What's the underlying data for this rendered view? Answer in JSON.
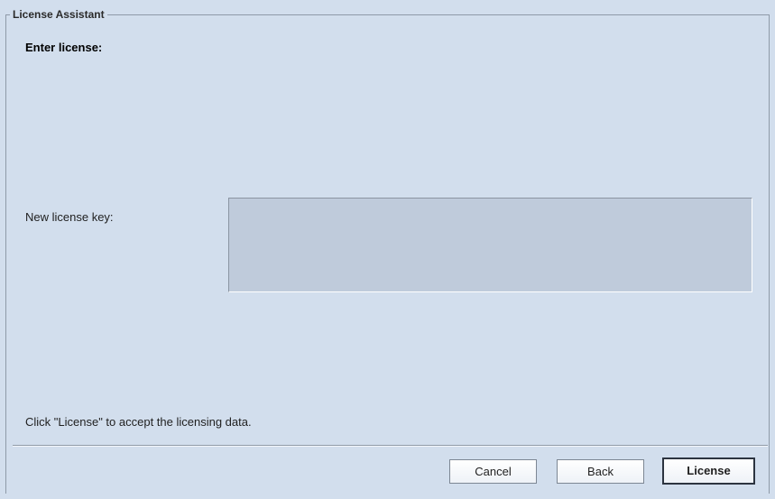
{
  "dialog": {
    "title": "License Assistant",
    "heading": "Enter license:",
    "license_key_label": "New license key:",
    "license_key_value": "",
    "hint": "Click \"License\" to accept the licensing data."
  },
  "buttons": {
    "cancel": "Cancel",
    "back": "Back",
    "license": "License"
  },
  "colors": {
    "panel_background": "#d2deed",
    "input_background": "#bfcbdb",
    "border": "#8f9aa8"
  }
}
